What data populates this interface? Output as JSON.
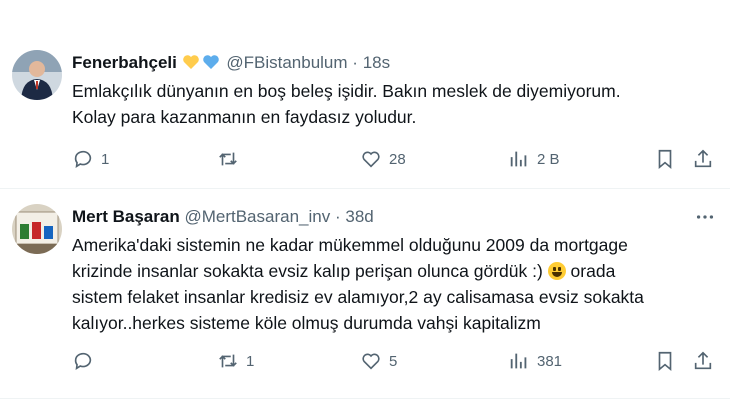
{
  "tweets": [
    {
      "name": "Fenerbahçeli",
      "handle": "@FBistanbulum",
      "separator": "·",
      "time": "18s",
      "text": "Emlakçılık dünyanın en boş beleş işidir. Bakın meslek de diyemiyorum.\nKolay para kazanmanın en faydasız yoludur.",
      "replies": "1",
      "reposts": "",
      "likes": "28",
      "views": "2 B"
    },
    {
      "name": "Mert Başaran",
      "handle": "@MertBasaran_inv",
      "separator": "·",
      "time": "38d",
      "text_lines": [
        "Amerika'daki sistemin ne kadar mükemmel olduğunu 2009 da mortgage",
        "krizinde insanlar sokakta evsiz kalıp perişan olunca gördük :)",
        "orada",
        "sistem felaket insanlar kredisiz ev alamıyor,2 ay calisamasa evsiz sokakta",
        "kalıyor..herkes sisteme köle olmuş durumda vahşi kapitalizm"
      ],
      "replies": "",
      "reposts": "1",
      "likes": "5",
      "views": "381"
    }
  ],
  "colors": {
    "heart_yellow": "#ffcc4d",
    "heart_blue": "#5dadec",
    "muted": "#536471",
    "divider": "#eff3f4"
  },
  "icons": [
    "reply-icon",
    "repost-icon",
    "like-icon",
    "views-icon",
    "bookmark-icon",
    "share-icon",
    "more-icon",
    "smile-emoji"
  ]
}
